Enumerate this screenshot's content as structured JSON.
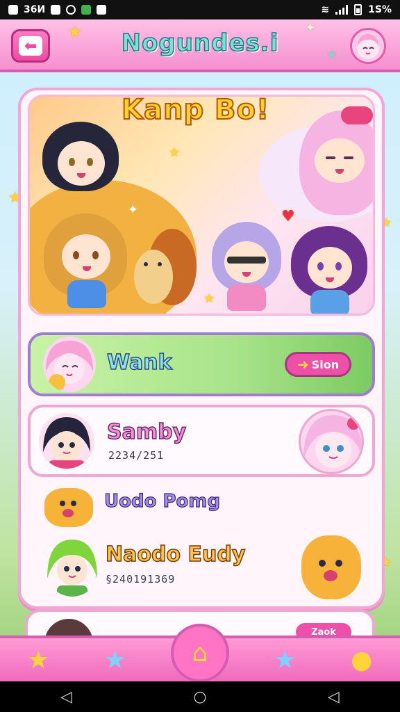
{
  "status_bar": {
    "left_text": "36И",
    "battery_text": "1S%"
  },
  "header": {
    "title": "Nogundes.i"
  },
  "hero": {
    "title": "Kanp Bo!"
  },
  "rows": [
    {
      "name": "Wank",
      "action_label": "Sion"
    },
    {
      "name": "Samby",
      "sub": "2234/251"
    },
    {
      "name": "Uodo Pomg"
    },
    {
      "name": "Naodo Eudy",
      "sub": "§240191369"
    },
    {
      "name": "",
      "action_label": "Zaok"
    }
  ],
  "colors": {
    "header": "#f58fd0",
    "accent_pink": "#ee4fa8",
    "star": "#ffd43b",
    "row_green": "#a8e38a"
  },
  "icons": {
    "back": "back-arrow-icon",
    "nav": [
      "star-icon",
      "star-icon",
      "home-icon",
      "star-icon",
      "mascot-icon"
    ]
  }
}
